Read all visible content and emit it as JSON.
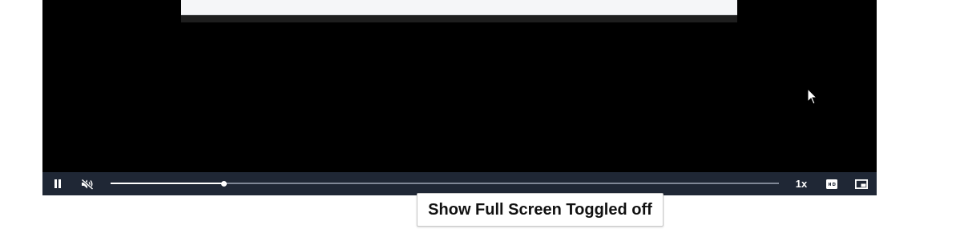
{
  "player": {
    "state": "playing",
    "muted": true,
    "progress_fraction": 0.169,
    "speed_label": "1x",
    "buttons": {
      "pause_icon": "pause-icon",
      "mute_icon": "volume-muted-icon",
      "quality_icon": "hd-icon",
      "pip_icon": "picture-in-picture-icon"
    }
  },
  "tooltip": {
    "text": "Show Full Screen Toggled off"
  },
  "colors": {
    "player_bg": "#000000",
    "control_bar_bg": "#1f2735",
    "progress_track": "#7f8796",
    "progress_fill": "#ffffff"
  }
}
